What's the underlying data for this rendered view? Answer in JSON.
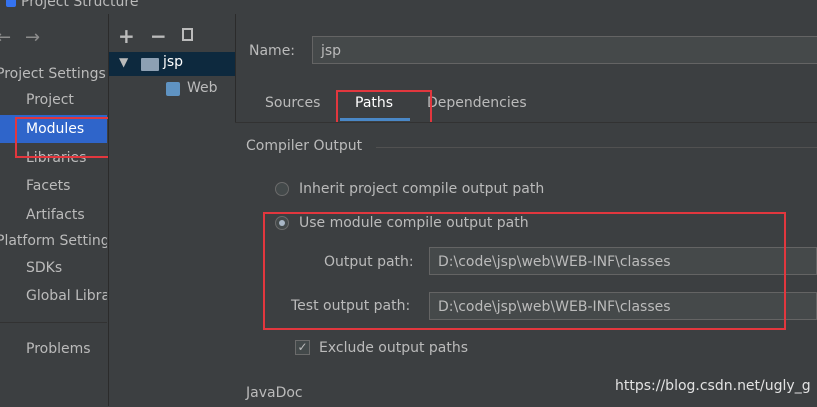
{
  "window": {
    "title": "Project Structure"
  },
  "nav": {
    "back_icon": "arrow-left-icon",
    "forward_icon": "arrow-right-icon",
    "section_project": "Project Settings",
    "project": "Project",
    "modules": "Modules",
    "libraries": "Libraries",
    "facets": "Facets",
    "artifacts": "Artifacts",
    "section_platform": "Platform Settings",
    "sdks": "SDKs",
    "global_libraries": "Global Libraries",
    "problems": "Problems"
  },
  "tree": {
    "add_icon": "plus-icon",
    "remove_icon": "minus-icon",
    "copy_icon": "copy-icon",
    "module": "jsp",
    "facet": "Web"
  },
  "module": {
    "name_label": "Name:",
    "name_value": "jsp",
    "tabs": [
      "Sources",
      "Paths",
      "Dependencies"
    ],
    "compiler_output_title": "Compiler Output",
    "inherit_option": "Inherit project compile output path",
    "use_module_option": "Use module compile output path",
    "output_path_label": "Output path:",
    "output_path_value": "D:\\code\\jsp\\web\\WEB-INF\\classes",
    "test_output_path_label": "Test output path:",
    "test_output_path_value": "D:\\code\\jsp\\web\\WEB-INF\\classes",
    "exclude_label": "Exclude output paths",
    "javadoc_title": "JavaDoc"
  },
  "watermark": "https://blog.csdn.net/ugly_g",
  "colors": {
    "accent": "#2f65ca",
    "annotation": "#e2373e"
  }
}
